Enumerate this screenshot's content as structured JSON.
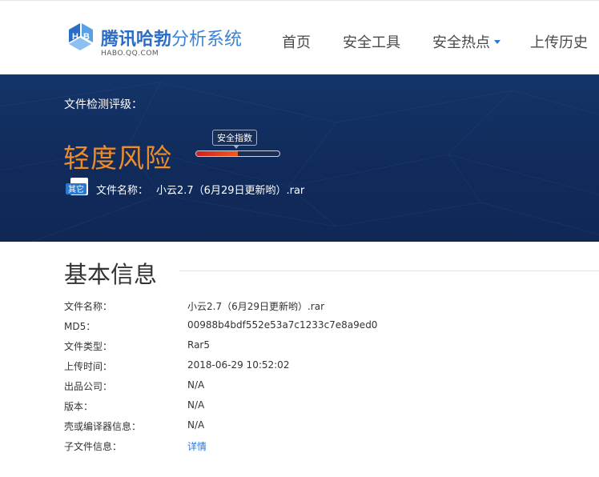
{
  "header": {
    "logo": {
      "name_strong": "腾讯哈勃",
      "name_light": "分析系统",
      "domain": "HABO.QQ.COM"
    },
    "nav": [
      {
        "label": "首页"
      },
      {
        "label": "安全工具"
      },
      {
        "label": "安全热点",
        "has_dropdown": true
      },
      {
        "label": "上传历史"
      }
    ]
  },
  "banner": {
    "title": "文件检测评级：",
    "risk_level": "轻度风险",
    "risk_color": "#f08c28",
    "meter": {
      "tooltip": "安全指数",
      "fill_fraction": 0.5
    },
    "file_icon_label": "其它",
    "file_name_label": "文件名称：",
    "file_name_value": "小云2.7（6月29日更新哟）.rar"
  },
  "basic_info": {
    "title": "基本信息",
    "rows": [
      {
        "label": "文件名称：",
        "value": "小云2.7（6月29日更新哟）.rar"
      },
      {
        "label": "MD5：",
        "value": "00988b4bdf552e53a7c1233c7e8a9ed0"
      },
      {
        "label": "文件类型：",
        "value": "Rar5"
      },
      {
        "label": "上传时间：",
        "value": "2018-06-29 10:52:02"
      },
      {
        "label": "出品公司：",
        "value": "N/A"
      },
      {
        "label": "版本：",
        "value": "N/A"
      },
      {
        "label": "壳或编译器信息：",
        "value": "N/A"
      },
      {
        "label": "子文件信息：",
        "value": "详情",
        "is_link": true
      }
    ]
  }
}
